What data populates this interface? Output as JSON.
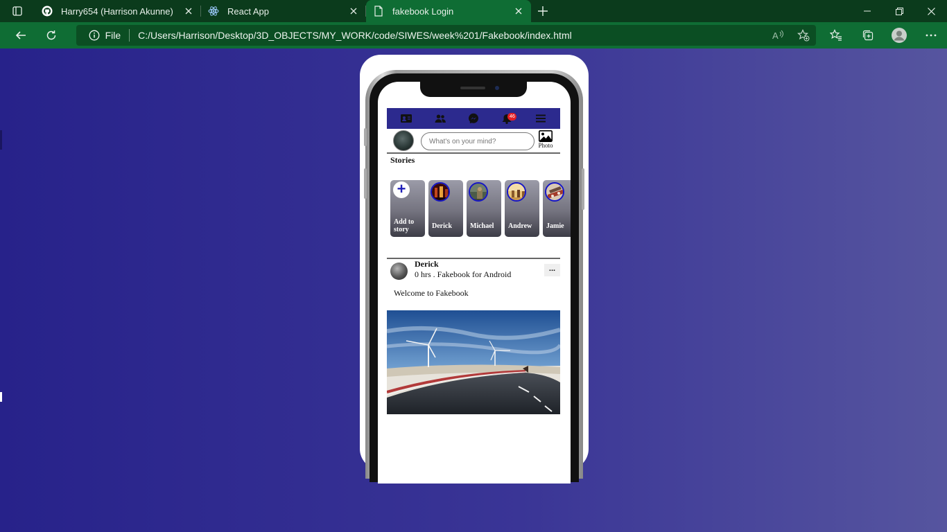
{
  "browser": {
    "tabs": [
      {
        "title": "Harry654 (Harrison Akunne)",
        "icon": "github-icon"
      },
      {
        "title": "React App",
        "icon": "react-icon"
      },
      {
        "title": "fakebook Login",
        "icon": "page-icon",
        "active": true
      }
    ],
    "address": {
      "info_label": "File",
      "url": "C:/Users/Harrison/Desktop/3D_OBJECTS/MY_WORK/code/SIWES/week%201/Fakebook/index.html"
    },
    "colors": {
      "frame": "#0b3b1c",
      "toolbar": "#0f6d34",
      "omnibox": "#0b4e23"
    }
  },
  "page": {
    "background_colors": [
      "#27228a",
      "#56559f"
    ]
  },
  "app": {
    "nav": {
      "icons": [
        "id-card-icon",
        "friends-icon",
        "messenger-icon",
        "bell-icon",
        "menu-icon"
      ],
      "notification_count": "46",
      "color": "#2c2a8e"
    },
    "composer": {
      "placeholder": "What's on your mind?",
      "photo_label": "Photo"
    },
    "stories": {
      "title": "Stories",
      "add_label": "Add to story",
      "items": [
        {
          "name": "Derick"
        },
        {
          "name": "Michael"
        },
        {
          "name": "Andrew"
        },
        {
          "name": "Jamie"
        }
      ]
    },
    "post": {
      "author": "Derick",
      "meta": "0 hrs . Fakebook for Android",
      "more_label": "...",
      "text": "Welcome to Fakebook",
      "image_subject": "road with wind turbines"
    }
  }
}
